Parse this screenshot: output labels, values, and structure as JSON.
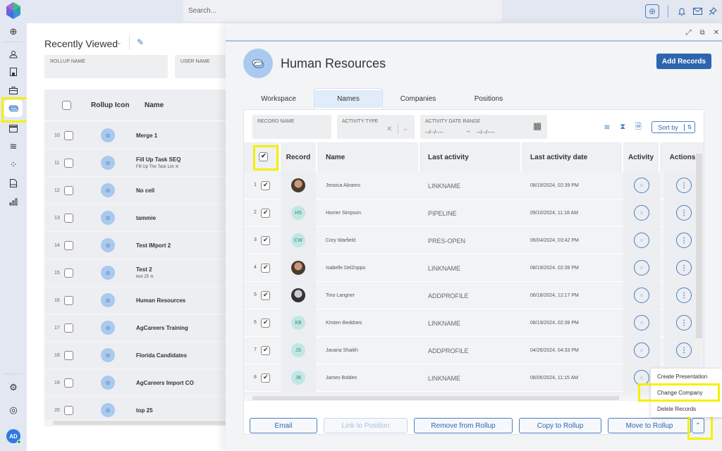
{
  "topbar": {
    "search_placeholder": "Search...",
    "icons": [
      "add-icon",
      "bell-icon",
      "mail-icon",
      "pin-icon"
    ]
  },
  "nav": {
    "items": [
      "expand-icon",
      "contacts-icon",
      "document-icon",
      "briefcase-icon",
      "rollup-icon",
      "calendar-icon",
      "workflow-icon",
      "activity-icon",
      "file-icon",
      "reports-icon"
    ],
    "active": "rollup-icon",
    "bottom": [
      "settings-icon",
      "help-icon"
    ],
    "user_initials": "AD"
  },
  "left_panel": {
    "title": "Recently Viewed",
    "filters": [
      "ROLLUP NAME",
      "USER NAME"
    ],
    "columns": [
      "Rollup Icon",
      "Name"
    ],
    "rows": [
      {
        "num": "10",
        "name": "Merge 1",
        "sub": ""
      },
      {
        "num": "11",
        "name": "Fill Up Task SEQ",
        "sub": "Fill Up The Task List"
      },
      {
        "num": "12",
        "name": "No cell",
        "sub": ""
      },
      {
        "num": "13",
        "name": "tammie",
        "sub": ""
      },
      {
        "num": "14",
        "name": "Test IMport 2",
        "sub": ""
      },
      {
        "num": "15",
        "name": "Test 2",
        "sub": "test 25"
      },
      {
        "num": "16",
        "name": "Human Resources",
        "sub": ""
      },
      {
        "num": "17",
        "name": "AgCareers Training",
        "sub": ""
      },
      {
        "num": "18",
        "name": "Florida Candidates",
        "sub": ""
      },
      {
        "num": "19",
        "name": "AgCareers Import CO",
        "sub": ""
      },
      {
        "num": "20",
        "name": "top 25",
        "sub": ""
      }
    ]
  },
  "drawer": {
    "title": "Human Resources",
    "add_button": "Add Records",
    "tabs": [
      "Workspace",
      "Names",
      "Companies",
      "Positions"
    ],
    "active_tab": "Names",
    "filters": {
      "record_name": "RECORD NAME",
      "activity_type": "ACTIVITY TYPE",
      "date_range": "ACTIVITY DATE RANGE",
      "date_from": "--/--/----",
      "date_to": "--/--/----"
    },
    "sort_label": "Sort by",
    "columns": [
      "Record",
      "Name",
      "Last activity",
      "Last activity date",
      "Activity",
      "Actions"
    ],
    "rows": [
      {
        "num": "1",
        "avatar": "photo",
        "initials": "",
        "name": "Jessica Abrams",
        "last_activity": "LINKNAME",
        "date": "08/19/2024, 02:39 PM",
        "checked": true
      },
      {
        "num": "2",
        "avatar": "initials",
        "initials": "HS",
        "name": "Homer Simpson",
        "last_activity": "PIPELINE",
        "date": "09/10/2024, 11:18 AM",
        "checked": true
      },
      {
        "num": "3",
        "avatar": "initials",
        "initials": "CW",
        "name": "Cory Warfield",
        "last_activity": "PRES-OPEN",
        "date": "06/04/2024, 03:42 PM",
        "checked": true
      },
      {
        "num": "4",
        "avatar": "photo",
        "initials": "",
        "name": "Isabelle DelZoppo",
        "last_activity": "LINKNAME",
        "date": "08/19/2024, 02:39 PM",
        "checked": true
      },
      {
        "num": "5",
        "avatar": "photo-bw",
        "initials": "",
        "name": "Tino Langner",
        "last_activity": "ADDPROFILE",
        "date": "06/18/2024, 12:17 PM",
        "checked": true
      },
      {
        "num": "6",
        "avatar": "initials",
        "initials": "KB",
        "name": "Kristen Beddoes",
        "last_activity": "LINKNAME",
        "date": "08/19/2024, 02:39 PM",
        "checked": true
      },
      {
        "num": "7",
        "avatar": "initials",
        "initials": "JS",
        "name": "Javaria Shaikh",
        "last_activity": "ADDPROFILE",
        "date": "04/26/2024, 04:33 PM",
        "checked": true
      },
      {
        "num": "8",
        "avatar": "initials",
        "initials": "JB",
        "name": "James Bolden",
        "last_activity": "LINKNAME",
        "date": "08/06/2024, 11:15 AM",
        "checked": true
      }
    ],
    "bottom_actions": [
      "Email",
      "Link to Position",
      "Remove from Rollup",
      "Copy to Rollup",
      "Move to Rollup"
    ],
    "disabled_actions": [
      "Link to Position"
    ],
    "more_menu": [
      "Create Presentation",
      "Change Company",
      "Delete Records"
    ]
  }
}
